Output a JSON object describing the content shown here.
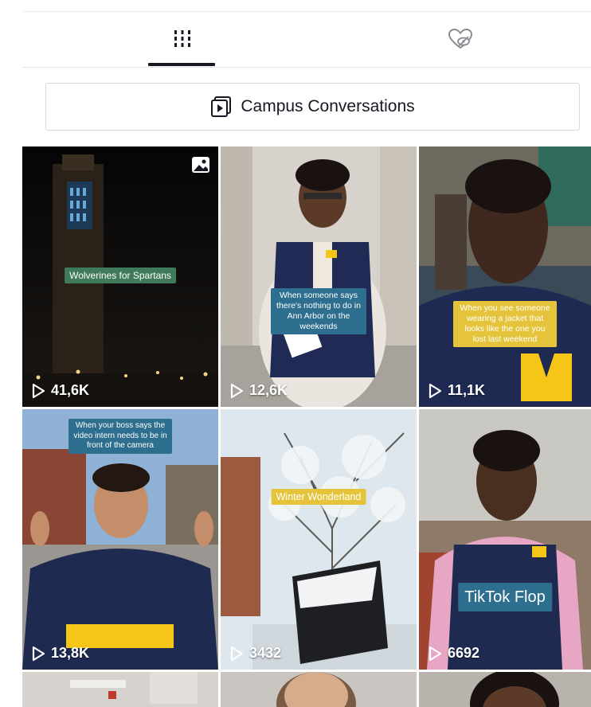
{
  "tabs": [
    {
      "name": "videos",
      "icon": "grid-icon",
      "active": true
    },
    {
      "name": "liked",
      "icon": "hidden-heart-icon",
      "active": false
    }
  ],
  "playlist": {
    "label": "Campus Conversations",
    "icon": "playlist-icon"
  },
  "videos": [
    {
      "caption": "Wolverines for Spartans",
      "views": "41,6K",
      "caption_color": "#3f7a5b",
      "badge": "photo-icon"
    },
    {
      "caption": "When someone says there's nothing to do in Ann Arbor on the weekends",
      "views": "12,6K",
      "caption_color": "#2e6e8e"
    },
    {
      "caption": "When you see someone wearing a jacket that looks like the one you lost last weekend",
      "views": "11,1K",
      "caption_color": "#e5c43c"
    },
    {
      "caption": "When your boss says the video intern needs to be in front of the camera",
      "views": "13,8K",
      "caption_color": "#2e6e8e"
    },
    {
      "caption": "Winter Wonderland",
      "views": "3432",
      "caption_color": "#e5c43c"
    },
    {
      "caption": "TikTok Flop",
      "views": "6692",
      "caption_color": "#2e6e8e"
    }
  ],
  "colors": {
    "accent": "#161823",
    "michigan_blue": "#1e2a50",
    "michigan_maize": "#f5c518"
  }
}
